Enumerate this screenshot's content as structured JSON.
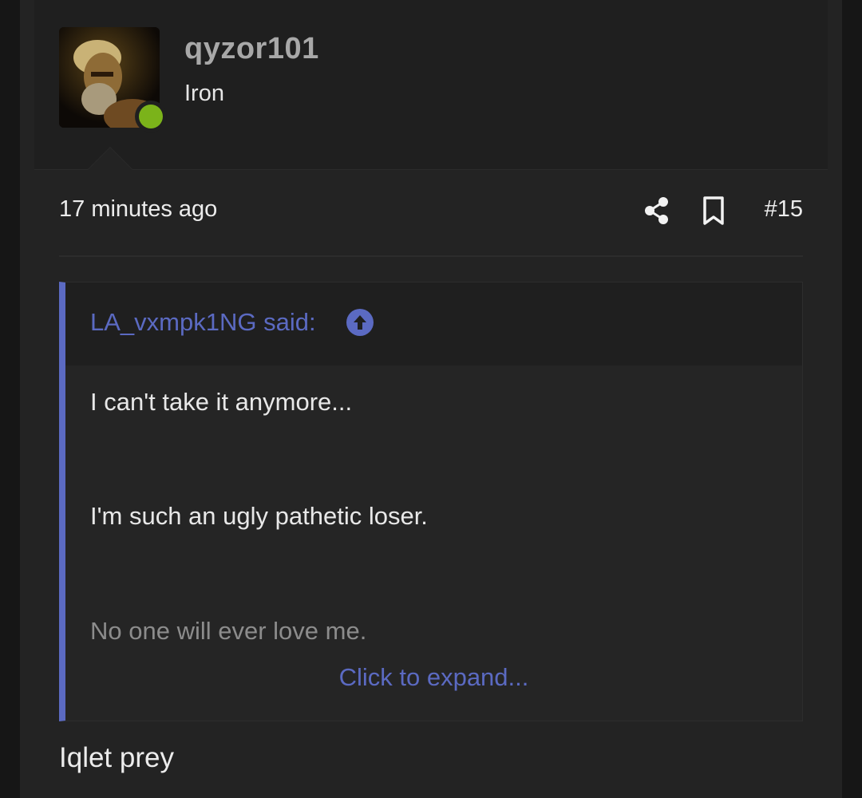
{
  "author": {
    "username": "qyzor101",
    "title": "Iron",
    "online": true,
    "avatar_icon": "avatar-image"
  },
  "post": {
    "timestamp": "17 minutes ago",
    "number": "#15",
    "share_icon": "share-icon",
    "bookmark_icon": "bookmark-icon",
    "body": "Iqlet prey"
  },
  "quote": {
    "author_label": "LA_vxmpk1NG said:",
    "jump_icon": "arrow-up-circle-icon",
    "lines": [
      "I can't take it anymore...",
      "I'm such an ugly pathetic loser.",
      "No one will ever love me."
    ],
    "expand_label": "Click to expand..."
  },
  "colors": {
    "accent": "#5b6ac2",
    "online": "#7bb31a",
    "background": "#232323",
    "header_background": "#1f1f1f"
  }
}
